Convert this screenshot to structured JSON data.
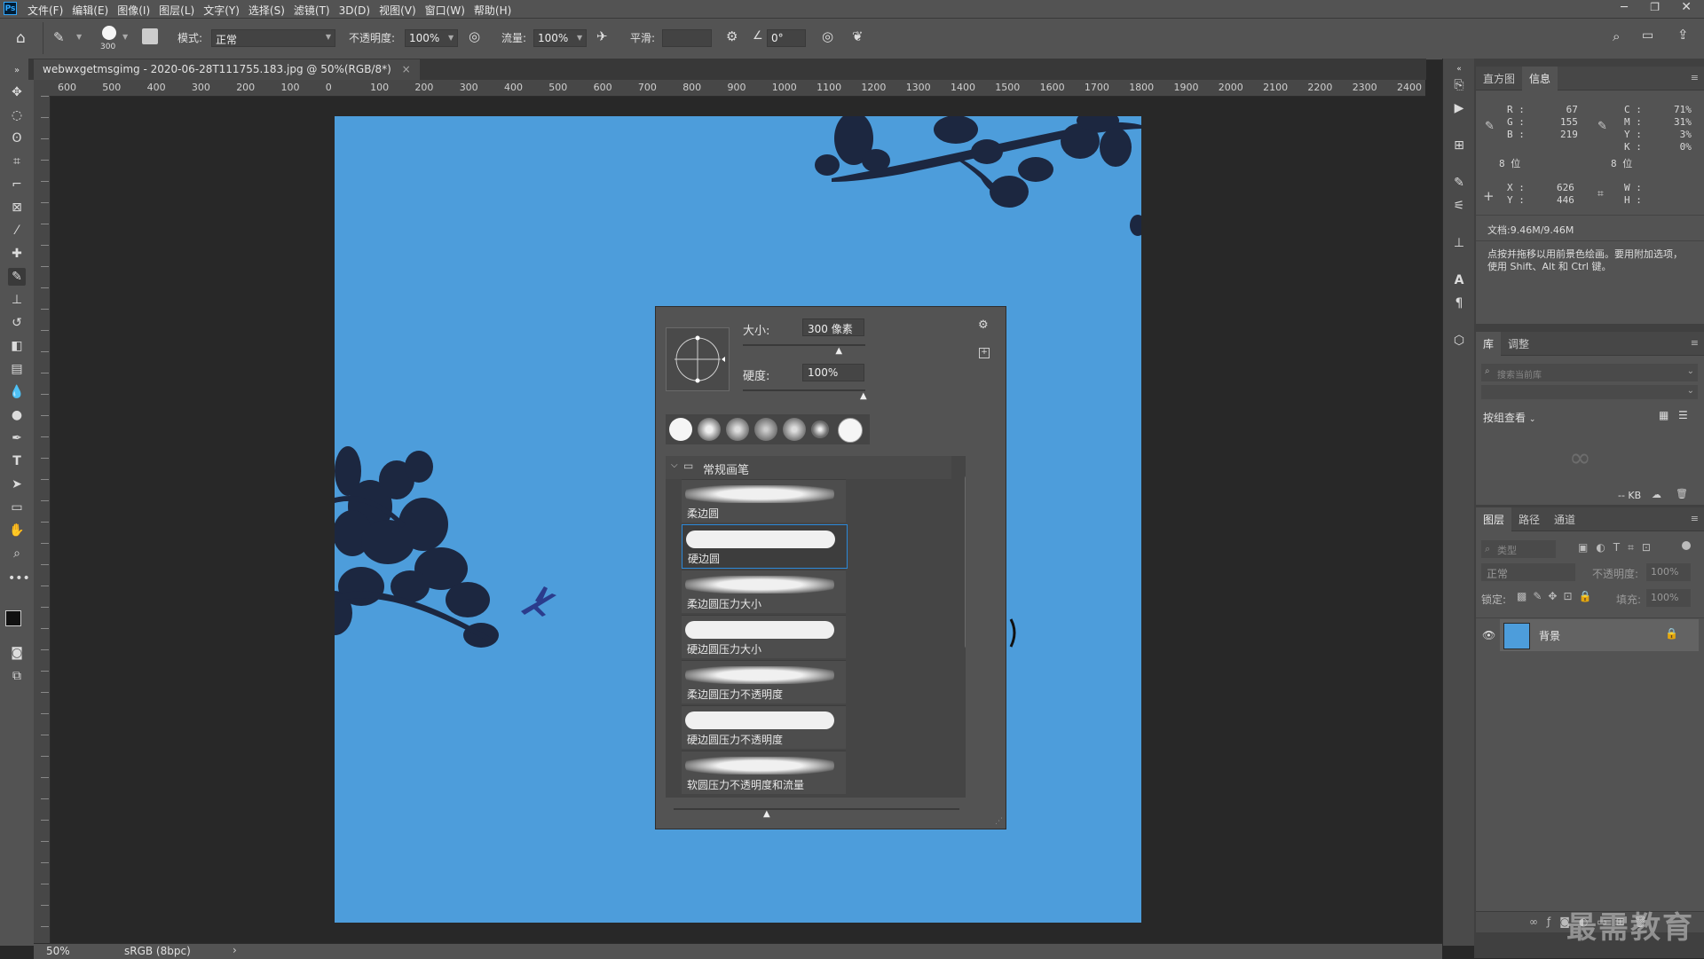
{
  "menubar": {
    "app_icon": "Ps",
    "items": [
      "文件(F)",
      "编辑(E)",
      "图像(I)",
      "图层(L)",
      "文字(Y)",
      "选择(S)",
      "滤镜(T)",
      "3D(D)",
      "视图(V)",
      "窗口(W)",
      "帮助(H)"
    ]
  },
  "options": {
    "brush_size_badge": "300",
    "mode_label": "模式:",
    "mode_value": "正常",
    "opacity_label": "不透明度:",
    "opacity_value": "100%",
    "flow_label": "流量:",
    "flow_value": "100%",
    "smoothing_label": "平滑:",
    "smoothing_value": "",
    "angle_value": "0°"
  },
  "document": {
    "tab_title": "webwxgetmsgimg - 2020-06-28T111755.183.jpg @ 50%(RGB/8*)",
    "ruler_labels": [
      "600",
      "500",
      "400",
      "300",
      "200",
      "100",
      "0",
      "100",
      "200",
      "300",
      "400",
      "500",
      "600",
      "700",
      "800",
      "900",
      "1000",
      "1100",
      "1200",
      "1300",
      "1400",
      "1500",
      "1600",
      "1700",
      "1800",
      "1900",
      "2000",
      "2100",
      "2200",
      "2300",
      "2400"
    ],
    "canvas_color": "#4d9ddb"
  },
  "brush_picker": {
    "size_label": "大小:",
    "size_value": "300 像素",
    "hardness_label": "硬度:",
    "hardness_value": "100%",
    "size_slider_fraction": 0.8,
    "hardness_slider_fraction": 1.0,
    "folder_name": "常规画笔",
    "brushes": [
      {
        "name": "柔边圆",
        "soft": true,
        "selected": false
      },
      {
        "name": "硬边圆",
        "soft": false,
        "selected": true
      },
      {
        "name": "柔边圆压力大小",
        "soft": true,
        "selected": false
      },
      {
        "name": "硬边圆压力大小",
        "soft": false,
        "selected": false
      },
      {
        "name": "柔边圆压力不透明度",
        "soft": true,
        "selected": false
      },
      {
        "name": "硬边圆压力不透明度",
        "soft": false,
        "selected": false
      },
      {
        "name": "软圆压力不透明度和流量",
        "soft": true,
        "selected": false
      }
    ]
  },
  "info_panel": {
    "tabs": [
      "直方图",
      "信息"
    ],
    "active_tab": "信息",
    "rgb": {
      "r_label": "R :",
      "r": "67",
      "g_label": "G :",
      "g": "155",
      "b_label": "B :",
      "b": "219",
      "bits": "8 位"
    },
    "cmyk": {
      "c_label": "C :",
      "c": "71%",
      "m_label": "M :",
      "m": "31%",
      "y_label": "Y :",
      "y": "3%",
      "k_label": "K :",
      "k": "0%",
      "bits": "8 位"
    },
    "coords": {
      "x_label": "X :",
      "x": "626",
      "y_label": "Y :",
      "y": "446",
      "w_label": "W :",
      "h_label": "H :"
    },
    "doc_size": "文档:9.46M/9.46M",
    "hint": "点按并拖移以用前景色绘画。要用附加选项，使用 Shift、Alt 和 Ctrl 键。"
  },
  "library_panel": {
    "tabs": [
      "库",
      "调整"
    ],
    "search_placeholder": "搜索当前库",
    "group_by": "按组查看",
    "size_text": "-- KB"
  },
  "layers_panel": {
    "tabs": [
      "图层",
      "路径",
      "通道"
    ],
    "filter_placeholder": "类型",
    "blend_mode": "正常",
    "opacity_label": "不透明度:",
    "opacity_value": "100%",
    "lock_label": "锁定:",
    "fill_label": "填充:",
    "fill_value": "100%",
    "layers": [
      {
        "name": "背景"
      }
    ]
  },
  "statusbar": {
    "zoom": "50%",
    "profile": "sRGB (8bpc)"
  },
  "watermark": "最需教育",
  "colors": {
    "accent": "#2b88d8",
    "sky": "#4d9ddb",
    "foliage": "#1c2740"
  }
}
